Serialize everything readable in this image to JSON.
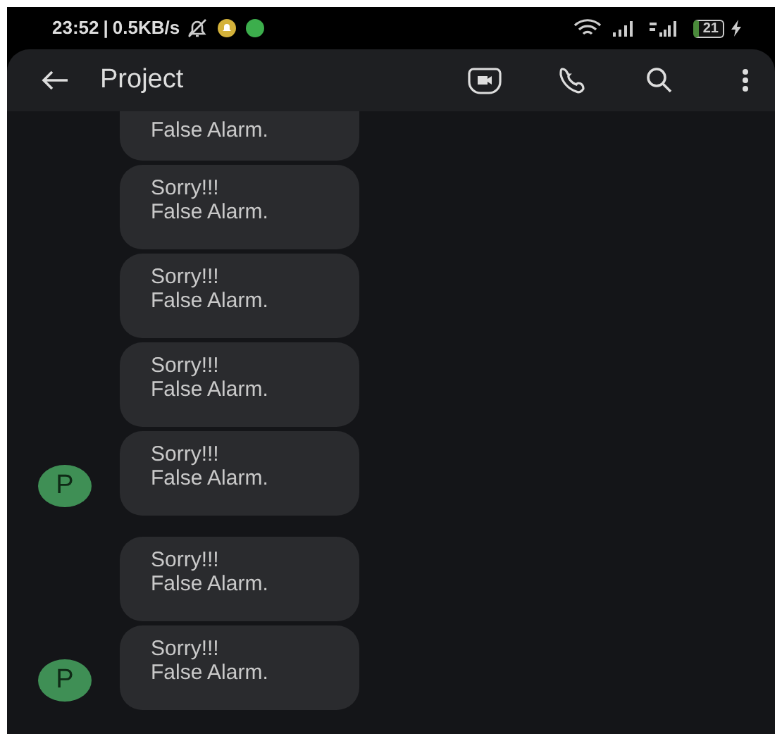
{
  "status_bar": {
    "time": "23:52",
    "separator": "|",
    "speed": "0.5KB/s",
    "battery": "21"
  },
  "header": {
    "title": "Project"
  },
  "groups": [
    {
      "avatar": "P",
      "messages": [
        {
          "text": "False Alarm."
        },
        {
          "text": "Sorry!!!\nFalse Alarm."
        },
        {
          "text": "Sorry!!!\nFalse Alarm."
        },
        {
          "text": "Sorry!!!\nFalse Alarm."
        },
        {
          "text": "Sorry!!!\nFalse Alarm."
        }
      ]
    },
    {
      "avatar": "P",
      "messages": [
        {
          "text": "Sorry!!!\nFalse Alarm."
        },
        {
          "text": "Sorry!!!\nFalse Alarm."
        }
      ]
    }
  ]
}
